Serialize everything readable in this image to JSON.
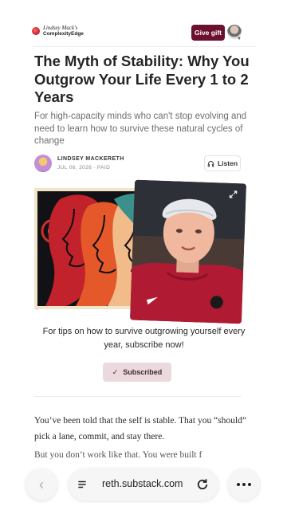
{
  "header": {
    "logo_line1": "Lindsey Mack's",
    "logo_line2": "ComplexityEdge",
    "give_gift_label": "Give gift"
  },
  "article": {
    "title": "The Myth of Stability: Why You Outgrow Your Life Every 1 to 2 Years",
    "subtitle": "For high-capacity minds who can't stop evolving and need to learn how to survive these natural cycles of change",
    "author": "LINDSEY MACKERETH",
    "date": "JUL 06, 2026",
    "access": "PAID",
    "meta_separator": "∙",
    "listen_label": "Listen"
  },
  "cta": {
    "text": "For tips on how to survive outgrowing yourself every year, subscribe now!",
    "subscribed_label": "Subscribed",
    "check_glyph": "✓"
  },
  "body": {
    "paragraph1": "You’ve been told that the self is stable. That you “should” pick a lane, commit, and stay there.",
    "paragraph2_partial": "But you don’t work like that. You were built f"
  },
  "browser": {
    "back_glyph": "‹",
    "url": "reth.substack.com"
  },
  "icons": {
    "headphones": "headphones-icon",
    "check": "check-icon",
    "expand": "expand-icon",
    "menu": "page-menu-icon",
    "reload": "reload-icon",
    "more": "more-dots-icon"
  },
  "colors": {
    "gift_button": "#6b1030",
    "subscribed_button": "#ecd9dd",
    "title": "#252525",
    "subtitle": "#6e6e6e"
  }
}
